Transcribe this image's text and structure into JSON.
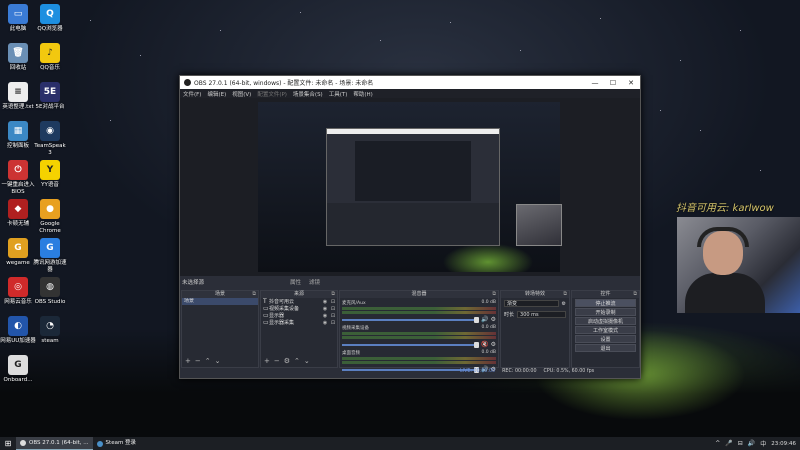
{
  "desktop_icons": [
    {
      "label": "此电脑",
      "color": "#3a7bd5",
      "glyph": "▭"
    },
    {
      "label": "QQ浏览器",
      "color": "#1d8fe0",
      "glyph": "Q"
    },
    {
      "label": "回收站",
      "color": "#6a8fb5",
      "glyph": "🗑"
    },
    {
      "label": "QQ音乐",
      "color": "#f2c80f",
      "glyph": "♪"
    },
    {
      "label": "英语整理.txt",
      "color": "#eeeeee",
      "glyph": "≡"
    },
    {
      "label": "5E对战平台",
      "color": "#2a2f6a",
      "glyph": "5E"
    },
    {
      "label": "控制面板",
      "color": "#3b88c4",
      "glyph": "▦"
    },
    {
      "label": "TeamSpeak 3",
      "color": "#1e3a5f",
      "glyph": "◉"
    },
    {
      "label": "一键重启进入BIOS",
      "color": "#cc3333",
      "glyph": "⏻"
    },
    {
      "label": "YY语音",
      "color": "#f5d200",
      "glyph": "Y"
    },
    {
      "label": "卡顿无辅",
      "color": "#b02020",
      "glyph": "◆"
    },
    {
      "label": "Google Chrome",
      "color": "#e8a020",
      "glyph": "●"
    },
    {
      "label": "wegame",
      "color": "#e0a020",
      "glyph": "G"
    },
    {
      "label": "腾讯网游加速器",
      "color": "#2a7ee0",
      "glyph": "G"
    },
    {
      "label": "网易云音乐",
      "color": "#d02a2a",
      "glyph": "◎"
    },
    {
      "label": "OBS Studio",
      "color": "#333333",
      "glyph": "◍"
    },
    {
      "label": "网易UU加速器",
      "color": "#2255aa",
      "glyph": "◐"
    },
    {
      "label": "steam",
      "color": "#1b2838",
      "glyph": "◔"
    },
    {
      "label": "Onboard...",
      "color": "#dddddd",
      "glyph": "G"
    }
  ],
  "obs": {
    "title": "OBS 27.0.1 (64-bit, windows) - 配置文件: 未命名 - 场景: 未命名",
    "window_buttons": [
      "—",
      "☐",
      "✕"
    ],
    "menu": [
      "文件(F)",
      "编辑(E)",
      "视图(V)",
      "配置文件(P)",
      "场景集合(S)",
      "工具(T)",
      "帮助(H)"
    ],
    "no_source_label": "未选择源",
    "ctrl_props": "属性",
    "ctrl_filters": "滤镜",
    "scenes": {
      "header": "场景",
      "items": [
        "场景"
      ]
    },
    "sources": {
      "header": "来源",
      "items": [
        {
          "icon": "T",
          "name": "抖音可用云"
        },
        {
          "icon": "▭",
          "name": "视频采集设备"
        },
        {
          "icon": "▭",
          "name": "显示器"
        },
        {
          "icon": "▭",
          "name": "显示器采集"
        }
      ]
    },
    "mixer": {
      "header": "混音器",
      "channels": [
        {
          "name": "麦克风/Aux",
          "db": "0.0 dB"
        },
        {
          "name": "视频采集设备",
          "db": "0.0 dB"
        },
        {
          "name": "桌面音频",
          "db": "0.0 dB"
        }
      ]
    },
    "transitions": {
      "header": "转场特效",
      "type": "渐变",
      "duration_label": "时长",
      "duration": "300 ms"
    },
    "controls": {
      "header": "控件",
      "buttons": [
        "停止推流",
        "开始录制",
        "启动虚拟摄像机",
        "工作室模式",
        "设置",
        "退出"
      ]
    },
    "status": {
      "live": "LIVE: 00:00:00",
      "rec": "REC: 00:00:00",
      "cpu": "CPU: 0.5%, 60.00 fps"
    }
  },
  "overlay": {
    "watermark": "抖音可用云: karlwow"
  },
  "taskbar": {
    "start_glyph": "⊞",
    "tasks": [
      {
        "label": "OBS 27.0.1 (64-bit, ..."
      },
      {
        "label": "Steam 登录"
      }
    ],
    "tray_icons": [
      "^",
      "🎤",
      "⊟",
      "🔊",
      "中"
    ],
    "clock": "23:09:46"
  }
}
